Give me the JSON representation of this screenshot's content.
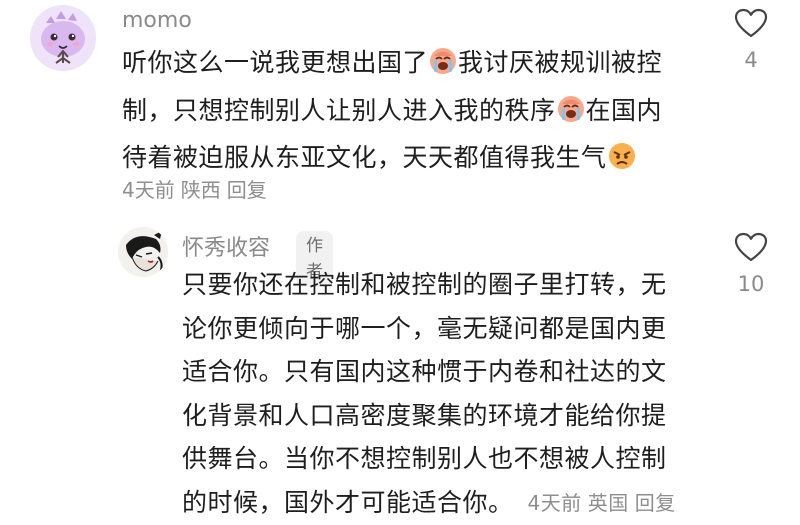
{
  "comments": [
    {
      "username": "momo",
      "avatar": "purple-dino-avatar",
      "lines": [
        "听你这么一说我更想出国了",
        "我讨厌被规训被控"
      ],
      "line2a": "制，只想控制别人让别人进入我的秩序",
      "line2b": "在国内",
      "line3a": "待着被迫服从东亚文化，天天都值得我生气",
      "time": "4天前",
      "location": "陕西",
      "reply_label": "回复",
      "likes": "4"
    },
    {
      "username": "怀秀收容",
      "badge": "作者",
      "avatar": "ink-drawing-avatar",
      "text_lines": [
        "只要你还在控制和被控制的圈子里打转，无",
        "论你更倾向于哪一个，毫无疑问都是国内更",
        "适合你。只有国内这种惯于内卷和社达的文",
        "化背景和人口高密度聚集的环境才能给你提",
        "供舞台。当你不想控制别人也不想被人控制",
        "的时候，国外才可能适合你。"
      ],
      "time": "4天前",
      "location": "英国",
      "reply_label": "回复",
      "likes": "10"
    }
  ],
  "icons": {
    "like": "heart-outline-icon",
    "emoji_cry": "loudly-crying-face",
    "emoji_angry": "angry-face"
  },
  "colors": {
    "meta_gray": "#8e8e8e",
    "avatar_purple": "#d9b8f0"
  }
}
